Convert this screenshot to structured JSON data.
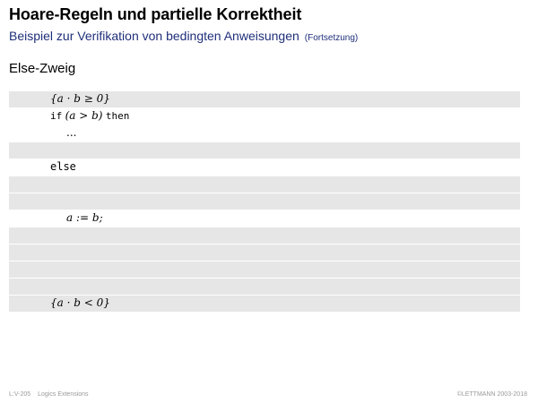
{
  "header": {
    "title": "Hoare-Regeln und partielle Korrektheit",
    "subtitle": "Beispiel zur Verifikation von bedingten Anweisungen",
    "subtitle_note": "(Fortsetzung)"
  },
  "section_title": "Else-Zweig",
  "code": {
    "pre": "{a · b ≥ 0}",
    "if_kw": "if",
    "condition": "(a > b)",
    "then_kw": "then",
    "ellipsis": "...",
    "else_kw": "else",
    "assign": "a := b;",
    "post": "{a · b < 0}"
  },
  "footer": {
    "slide_id": "L:V-205",
    "course": "Logics Extensions",
    "copyright": "©LETTMANN 2003-2018"
  }
}
